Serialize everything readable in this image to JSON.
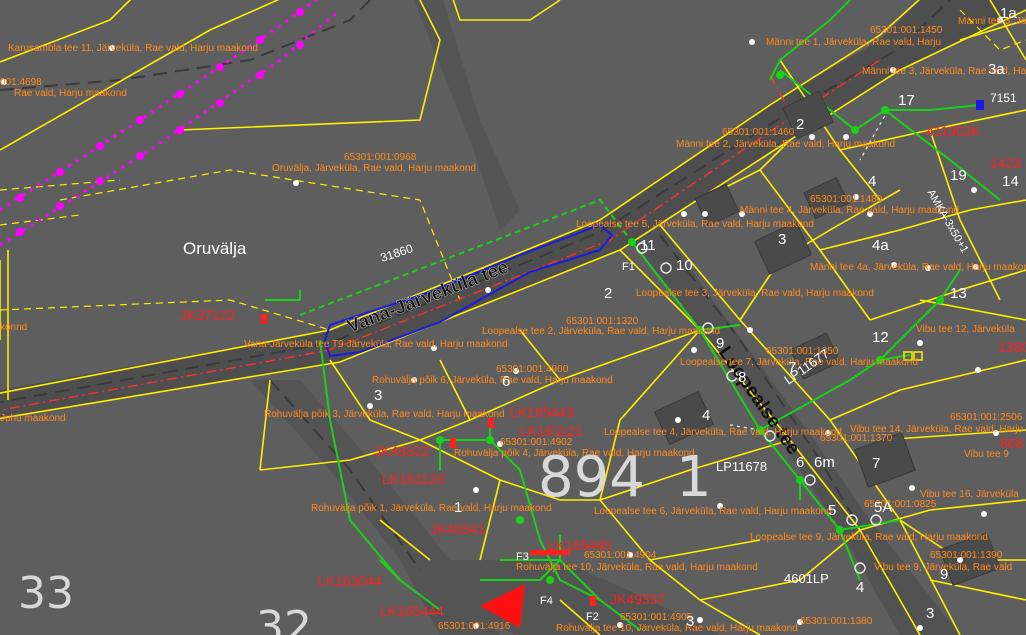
{
  "map": {
    "colors": {
      "background": "#5e5e5e",
      "parcel_boundary": "#ffee00",
      "cable_line": "#19d119",
      "address_text": "#ff8a1c",
      "red_labels": "#ff2020",
      "power_line": "#ff00ff",
      "highlight_outline": "#1a1ae0"
    },
    "street_label": "Vana-Järveküla tee",
    "place_name": "Oruvälja",
    "line_length_label": "31860",
    "address_labels": [
      "Karusambla tee 11, Järveküla, Rae vald, Harju maakond",
      "001:4698",
      "Rae vald, Harju maakond",
      "65301:001:0968",
      "Oruvälja, Järveküla, Rae vald, Harju maakond",
      "konnd",
      "Vana-Järveküla tee T9 Järveküla, Rae vald, Harju maakond",
      "Loopealse tee 2, Järveküla, Rae vald, Harju maakond",
      "65301:001:1320",
      "65301:001:4900",
      "Rohuvälja põik 6, Järveküla, Rae vald, Harju maakond",
      "Rohuvälja põik 3, Järveküla, Rae vald, Harju maakond",
      "Rohuvälja põik 4, Järveküla, Rae vald, Harju maakond",
      "Loopealse tee 4, Järveküla, Rae vald, Harju maakond",
      "65301:001:4902",
      "Rohuvälja põik 1, Järveküla, Rae vald, Harju maakond",
      "Loopealse tee 6, Järveküla, Rae vald, Harju maakond",
      "Rohuvälja tee 10, Järveküla, Rae vald, Harju maakond",
      "65301:001:4904",
      "65301:001:4905",
      "65301:001:4916",
      "Rohuvälja tee 10, Järveküla, Rae vald, Harju maakond",
      "Juhu maakond",
      "Männi tee 2, Järveküla, Rae vald, Harju maakond",
      "65301:001:1460",
      "Männi tee 4, Järveküla, Rae vald, Harju maakond",
      "Loopealse tee 5, Järveküla, Rae vald, Harju maakond",
      "65301:001:1480",
      "Loopealse tee 3, Järveküla, Rae vald, Harju maakond",
      "Männi tee 4a, Järveküla, Rae vald, Harju maakond",
      "65301:001:1350",
      "Loopealse tee 7, Järveküla, Rae vald, Harju maakond",
      "Vibu tee 12, Järveküla",
      "Vibu tee 14, Järveküla, Rae vald, Harju maakond",
      "65301:001:1370",
      "65301:001:2506",
      "Vibu tee 16, Järveküla",
      "65301:001:0825",
      "Vibu tee 9, Järveküla, Rae vald",
      "65301:001:1390",
      "65301:001:1380",
      "Männi tee 1, Järveküla, Rae vald, Harju",
      "Männi tee 3, Järveküla, Rae vald, Harju",
      "Männi tee 5, Järveküla",
      "65301:001:1450",
      "Vibu tee 9",
      "Loopealse tee 9, Järveküla, Rae vald, Harju maakond"
    ],
    "numbers": [
      "3",
      "6",
      "1",
      "2",
      "3",
      "3",
      "2",
      "4",
      "4",
      "4a",
      "19",
      "17",
      "13",
      "12",
      "10",
      "11",
      "9",
      "8",
      "7",
      "6",
      "5",
      "5A",
      "4",
      "3",
      "9",
      "7",
      "1a",
      "3a",
      "14",
      "6m"
    ],
    "big_numbers": [
      "894",
      "1",
      "33",
      "32"
    ],
    "red_labels": [
      "JK37122",
      "JK49322",
      "LK161120",
      "JK49341",
      "LK163044",
      "LK165444",
      "JK49337",
      "LK165445",
      "LK165443",
      "LK161121",
      "41190JK",
      "1380",
      "1423",
      "868"
    ],
    "white_labels": [
      "LP11678",
      "LP11677",
      "4601LP",
      "F1",
      "F2",
      "F3",
      "F4",
      "7151",
      "AMKA-3x50+1"
    ]
  }
}
